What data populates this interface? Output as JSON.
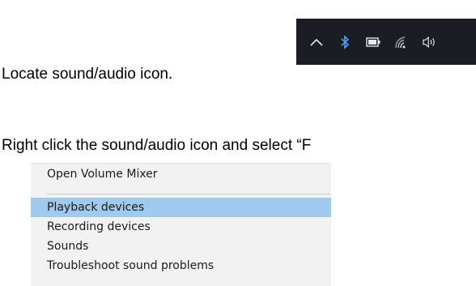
{
  "step1": {
    "text": "Locate sound/audio icon."
  },
  "taskbar": {
    "icons": [
      "chevron-up-icon",
      "bluetooth-icon",
      "battery-icon",
      "wifi-icon",
      "speaker-icon"
    ],
    "background": "#1b1d24"
  },
  "step2": {
    "text": "Right click the sound/audio icon and select “F"
  },
  "context_menu": {
    "items": [
      {
        "label": "Open Volume Mixer"
      },
      {
        "label": "Playback devices",
        "selected": true
      },
      {
        "label": "Recording devices"
      },
      {
        "label": "Sounds"
      },
      {
        "label": "Troubleshoot sound problems"
      }
    ],
    "highlight_color": "#9fc9ed"
  }
}
